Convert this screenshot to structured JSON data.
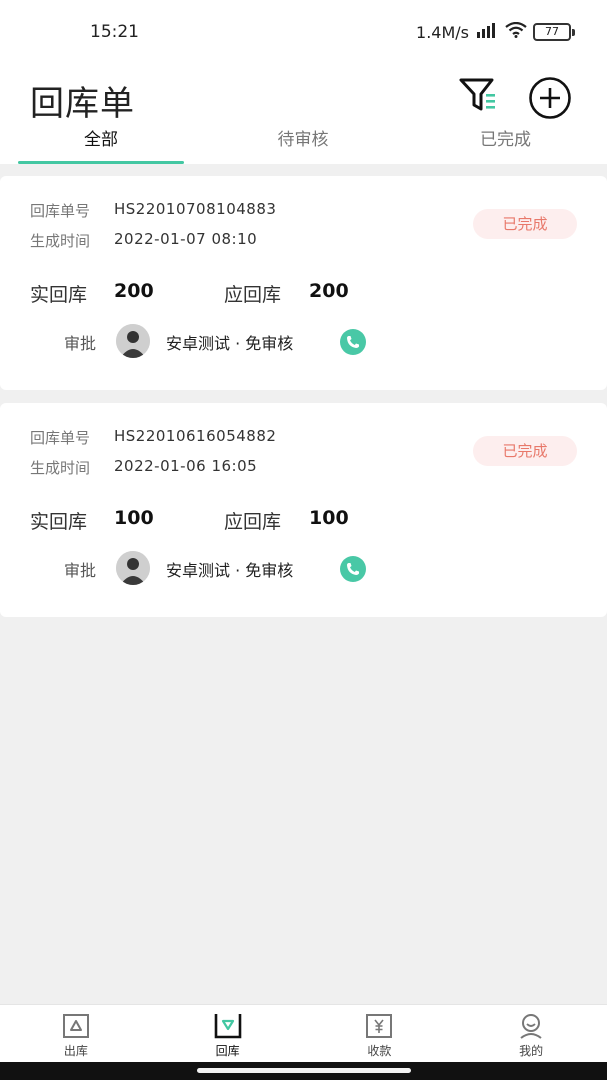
{
  "status_bar": {
    "time": "15:21",
    "net_speed": "1.4M/s",
    "battery": "77"
  },
  "header": {
    "title": "回库单",
    "tabs": [
      {
        "label": "全部",
        "active": true
      },
      {
        "label": "待审核",
        "active": false
      },
      {
        "label": "已完成",
        "active": false
      }
    ],
    "filter_icon": "filter-icon",
    "add_icon": "plus-circle-icon"
  },
  "labels": {
    "order_no": "回库单号",
    "created_at": "生成时间",
    "actual": "实回库",
    "expected": "应回库",
    "approve": "审批"
  },
  "cards": [
    {
      "order_no": "HS22010708104883",
      "created_at": "2022-01-07 08:10",
      "status": "已完成",
      "actual": "200",
      "expected": "200",
      "approver": "安卓测试 · 免审核"
    },
    {
      "order_no": "HS22010616054882",
      "created_at": "2022-01-06 16:05",
      "status": "已完成",
      "actual": "100",
      "expected": "100",
      "approver": "安卓测试 · 免审核"
    }
  ],
  "bottom_nav": [
    {
      "label": "出库",
      "icon": "outbound-icon",
      "active": false
    },
    {
      "label": "回库",
      "icon": "return-icon",
      "active": true
    },
    {
      "label": "收款",
      "icon": "yuan-icon",
      "active": false
    },
    {
      "label": "我的",
      "icon": "profile-icon",
      "active": false
    }
  ],
  "colors": {
    "accent": "#43c7a2",
    "status_text": "#e8786a",
    "status_bg": "#fdeeee",
    "phone": "#49c8a6"
  }
}
